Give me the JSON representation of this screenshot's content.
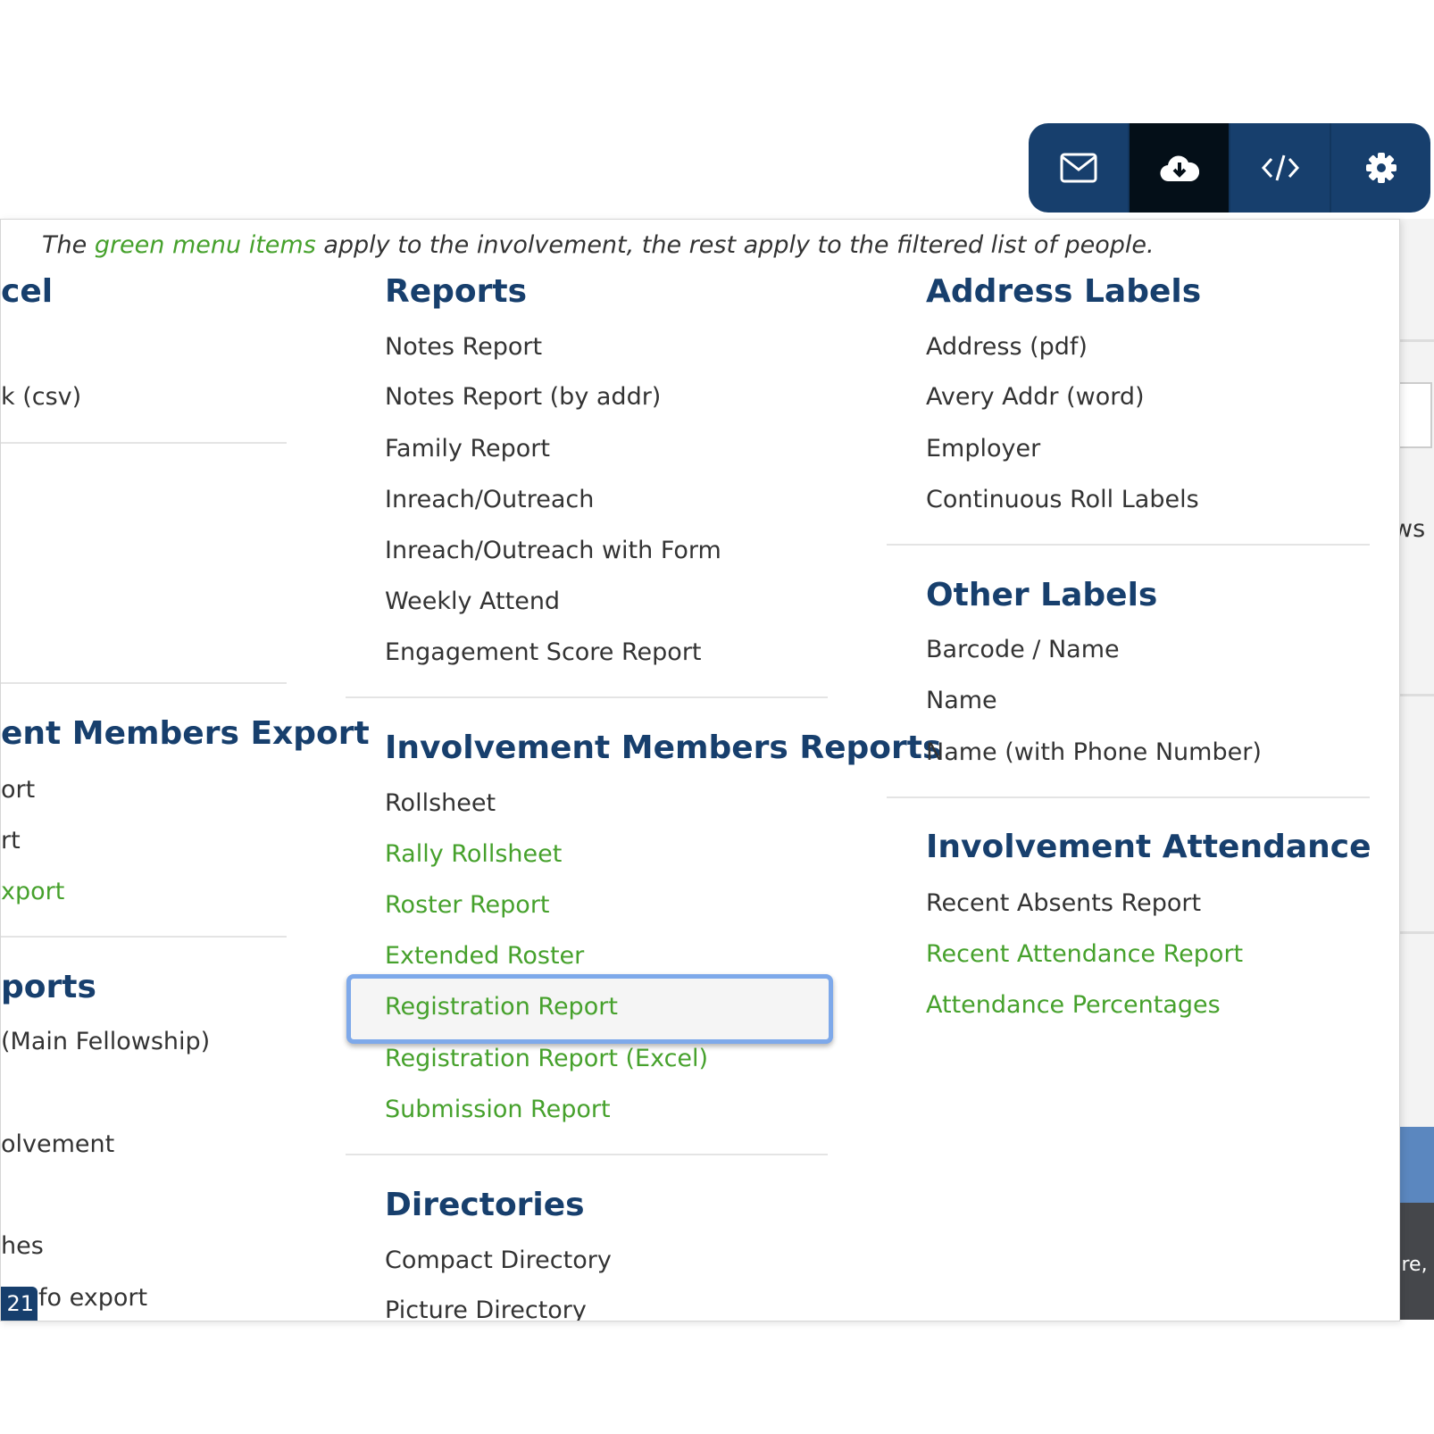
{
  "toolbar": {
    "buttons": [
      {
        "icon": "envelope-icon"
      },
      {
        "icon": "cloud-download-icon",
        "active": true
      },
      {
        "icon": "code-icon"
      },
      {
        "icon": "gear-icon"
      }
    ]
  },
  "note": {
    "prefix": "The ",
    "green": "green menu items",
    "suffix": " apply to the involvement, the rest apply to the filtered list of people."
  },
  "col1": {
    "heading1": "cel",
    "items1": [
      "k (csv)"
    ],
    "heading2": "ent Members Export",
    "items2": [
      "ort",
      "rt",
      "xport"
    ],
    "heading3": "ports",
    "items3": [
      "(Main Fellowship)",
      "olvement",
      "hes",
      "fo export"
    ],
    "badge": "21"
  },
  "reports": {
    "heading": "Reports",
    "items": [
      "Notes Report",
      "Notes Report (by addr)",
      "Family Report",
      "Inreach/Outreach",
      "Inreach/Outreach with Form",
      "Weekly Attend",
      "Engagement Score Report"
    ]
  },
  "inv_members_reports": {
    "heading": "Involvement Members Reports",
    "items": [
      "Rollsheet",
      "Rally Rollsheet",
      "Roster Report",
      "Extended Roster",
      "Registration Report",
      "Registration Report (Excel)",
      "Submission Report"
    ]
  },
  "directories": {
    "heading": "Directories",
    "items": [
      "Compact Directory",
      "Picture Directory"
    ]
  },
  "address_labels": {
    "heading": "Address Labels",
    "items": [
      "Address (pdf)",
      "Avery Addr (word)",
      "Employer",
      "Continuous Roll Labels"
    ]
  },
  "other_labels": {
    "heading": "Other Labels",
    "items": [
      "Barcode / Name",
      "Name",
      "Name (with Phone Number)"
    ]
  },
  "inv_attendance": {
    "heading": "Involvement Attendance",
    "items": [
      "Recent Absents Report",
      "Recent Attendance Report",
      "Attendance Percentages"
    ]
  },
  "background": {
    "text1": "ws",
    "text2": "are,"
  },
  "colors": {
    "heading": "#173f6d",
    "green": "#46a12c",
    "toolbar": "#173f6d",
    "active": "#040f18",
    "highlight": "#7ea9ea"
  }
}
